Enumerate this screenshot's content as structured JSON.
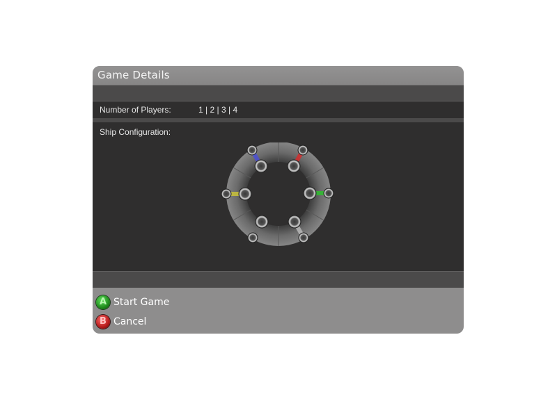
{
  "dialog": {
    "title": "Game Details"
  },
  "players": {
    "label": "Number of Players:",
    "options": [
      "1",
      "2",
      "3",
      "4"
    ],
    "separator": " | "
  },
  "ship_config": {
    "label": "Ship Configuration:",
    "slots": [
      {
        "position": "top-left",
        "color": "#4b4fd6"
      },
      {
        "position": "top-right",
        "color": "#d42d2d"
      },
      {
        "position": "left",
        "color": "#c9c23a"
      },
      {
        "position": "right",
        "color": "#2fbf2f"
      },
      {
        "position": "bottom-left",
        "color": "#6a6a6a"
      },
      {
        "position": "bottom-right",
        "color": "#b8b8b8"
      }
    ]
  },
  "actions": {
    "start": {
      "button_glyph": "A",
      "label": "Start Game",
      "button_icon": "a-button-icon",
      "color": "#2fa52b"
    },
    "cancel": {
      "button_glyph": "B",
      "label": "Cancel",
      "button_icon": "b-button-icon",
      "color": "#c42020"
    }
  }
}
